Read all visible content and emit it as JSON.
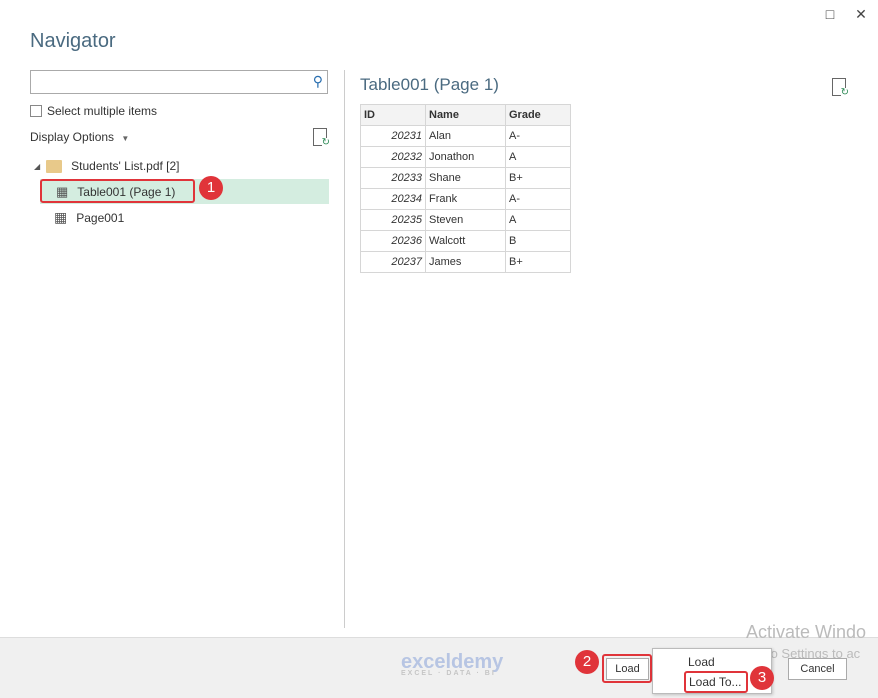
{
  "window": {
    "title": "Navigator",
    "maximize_icon": "□",
    "close_icon": "✕"
  },
  "left": {
    "search": {
      "value": "",
      "placeholder": ""
    },
    "select_multiple": "Select multiple items",
    "display_options": "Display Options",
    "tree": {
      "file": "Students' List.pdf [2]",
      "items": [
        "Table001 (Page 1)",
        "Page001"
      ],
      "selected": "Table001 (Page 1)"
    }
  },
  "preview": {
    "title": "Table001 (Page 1)",
    "columns": [
      "ID",
      "Name",
      "Grade"
    ],
    "rows": [
      [
        "20231",
        "Alan",
        "A-"
      ],
      [
        "20232",
        "Jonathon",
        "A"
      ],
      [
        "20233",
        "Shane",
        "B+"
      ],
      [
        "20234",
        "Frank",
        "A-"
      ],
      [
        "20235",
        "Steven",
        "A"
      ],
      [
        "20236",
        "Walcott",
        "B"
      ],
      [
        "20237",
        "James",
        "B+"
      ]
    ]
  },
  "footer": {
    "load": "Load",
    "cancel": "Cancel",
    "menu": [
      "Load",
      "Load To..."
    ],
    "logo": "exceldemy",
    "logo_sub": "EXCEL · DATA · BI",
    "watermark1": "Activate Windo",
    "watermark2": "Go to Settings to ac"
  },
  "annotations": [
    "1",
    "2",
    "3"
  ],
  "colors": {
    "accent": "#d4ede0",
    "annotation": "#e0343a"
  }
}
